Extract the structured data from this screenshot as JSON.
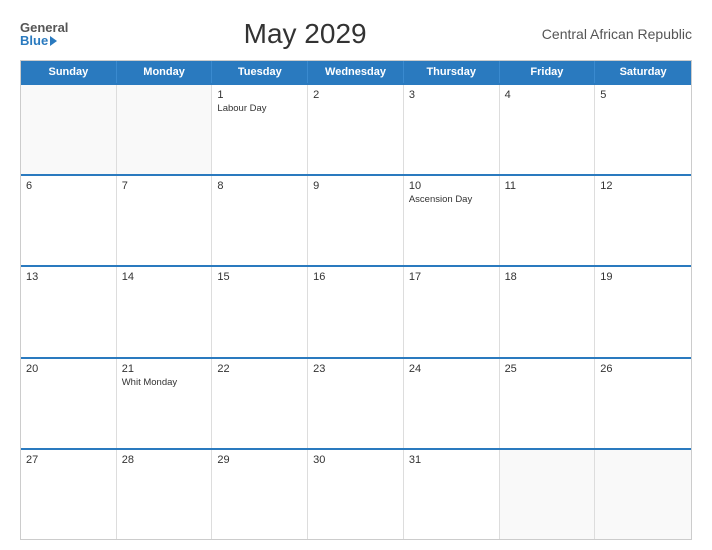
{
  "logo": {
    "general": "General",
    "blue": "Blue"
  },
  "title": "May 2029",
  "country": "Central African Republic",
  "calendar": {
    "headers": [
      "Sunday",
      "Monday",
      "Tuesday",
      "Wednesday",
      "Thursday",
      "Friday",
      "Saturday"
    ],
    "weeks": [
      [
        {
          "day": "",
          "holiday": "",
          "empty": true
        },
        {
          "day": "",
          "holiday": "",
          "empty": true
        },
        {
          "day": "1",
          "holiday": "Labour Day"
        },
        {
          "day": "2",
          "holiday": ""
        },
        {
          "day": "3",
          "holiday": ""
        },
        {
          "day": "4",
          "holiday": ""
        },
        {
          "day": "5",
          "holiday": ""
        }
      ],
      [
        {
          "day": "6",
          "holiday": ""
        },
        {
          "day": "7",
          "holiday": ""
        },
        {
          "day": "8",
          "holiday": ""
        },
        {
          "day": "9",
          "holiday": ""
        },
        {
          "day": "10",
          "holiday": "Ascension Day"
        },
        {
          "day": "11",
          "holiday": ""
        },
        {
          "day": "12",
          "holiday": ""
        }
      ],
      [
        {
          "day": "13",
          "holiday": ""
        },
        {
          "day": "14",
          "holiday": ""
        },
        {
          "day": "15",
          "holiday": ""
        },
        {
          "day": "16",
          "holiday": ""
        },
        {
          "day": "17",
          "holiday": ""
        },
        {
          "day": "18",
          "holiday": ""
        },
        {
          "day": "19",
          "holiday": ""
        }
      ],
      [
        {
          "day": "20",
          "holiday": ""
        },
        {
          "day": "21",
          "holiday": "Whit Monday"
        },
        {
          "day": "22",
          "holiday": ""
        },
        {
          "day": "23",
          "holiday": ""
        },
        {
          "day": "24",
          "holiday": ""
        },
        {
          "day": "25",
          "holiday": ""
        },
        {
          "day": "26",
          "holiday": ""
        }
      ],
      [
        {
          "day": "27",
          "holiday": ""
        },
        {
          "day": "28",
          "holiday": ""
        },
        {
          "day": "29",
          "holiday": ""
        },
        {
          "day": "30",
          "holiday": ""
        },
        {
          "day": "31",
          "holiday": ""
        },
        {
          "day": "",
          "holiday": "",
          "empty": true
        },
        {
          "day": "",
          "holiday": "",
          "empty": true
        }
      ]
    ]
  }
}
